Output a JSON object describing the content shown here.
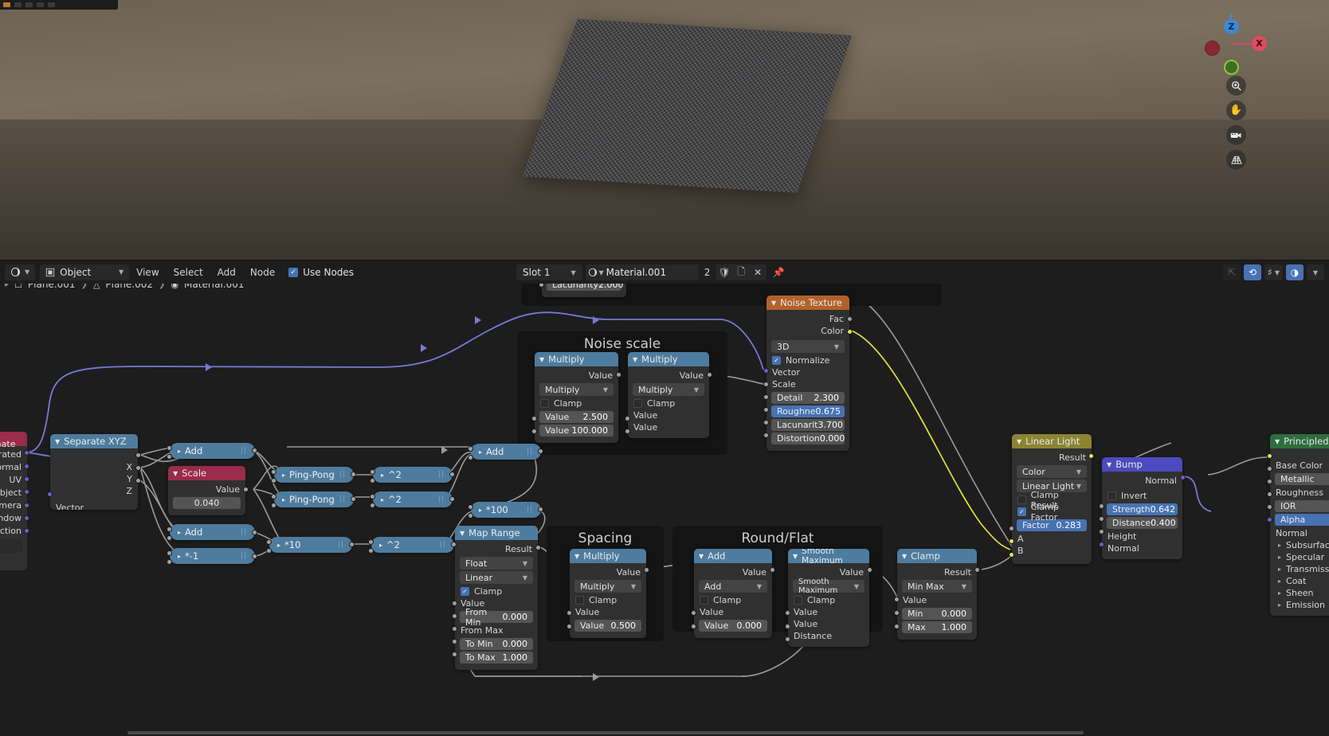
{
  "app": {
    "name": "Blender Shader Editor",
    "viewport": {
      "gizmo_axes": [
        "Z",
        "X"
      ],
      "tools": [
        {
          "name": "zoom-tool",
          "glyph": "⌕"
        },
        {
          "name": "pan-tool",
          "glyph": "✋"
        },
        {
          "name": "camera-tool",
          "glyph": "🎥"
        },
        {
          "name": "grid-tool",
          "glyph": "▦"
        }
      ]
    }
  },
  "header": {
    "editor_type": "shader-editor-icon",
    "shader_type": "Object",
    "menus": [
      "View",
      "Select",
      "Add",
      "Node"
    ],
    "use_nodes_label": "Use Nodes",
    "use_nodes_checked": true,
    "slot": "Slot 1",
    "material_name": "Material.001",
    "users_count": "2",
    "fake_user_icon": "shield-icon",
    "copy_icon": "copy-icon",
    "unlink_icon": "x-icon",
    "pin_icon": "pin-icon",
    "right_tools": [
      {
        "name": "snap-parent-icon",
        "glyph": "⤴",
        "active": false,
        "dim": true
      },
      {
        "name": "snap-magnet-icon",
        "glyph": "⟳",
        "active": true,
        "dim": false
      },
      {
        "name": "snap-target-icon",
        "glyph": "⌗",
        "active": false,
        "dim": false
      },
      {
        "name": "overlays-icon",
        "glyph": "◑",
        "active": true,
        "dim": false
      }
    ]
  },
  "breadcrumb": [
    {
      "icon": "object-icon",
      "label": "Plane.001"
    },
    {
      "icon": "mesh-data-icon",
      "label": "Plane.002"
    },
    {
      "icon": "material-icon",
      "label": "Material.001"
    }
  ],
  "frames": [
    {
      "title": "Noise scale"
    },
    {
      "title": "Spacing"
    },
    {
      "title": "Round/Flat"
    }
  ],
  "nodes": {
    "tex_coord": {
      "title": "Texture Coordinate",
      "outputs": [
        "Generated",
        "Normal",
        "UV",
        "Object",
        "Camera",
        "Window",
        "Reflection"
      ],
      "object_field": "Object"
    },
    "separate_xyz": {
      "title": "Separate XYZ",
      "outputs": [
        "X",
        "Y",
        "Z"
      ],
      "inputs": [
        "Vector"
      ]
    },
    "scale": {
      "title": "Scale",
      "output": "Value",
      "value": "0.040"
    },
    "add_top": {
      "title": "Add"
    },
    "add_mid": {
      "title": "Add"
    },
    "mul_neg1": {
      "title": "*-1"
    },
    "pingpong_1": {
      "title": "Ping-Pong"
    },
    "pingpong_2": {
      "title": "Ping-Pong"
    },
    "pow2_1": {
      "title": "^2"
    },
    "pow2_2": {
      "title": "^2"
    },
    "mul10": {
      "title": "*10"
    },
    "pow2_3": {
      "title": "^2"
    },
    "add_right": {
      "title": "Add"
    },
    "mul100": {
      "title": "*100"
    },
    "noise_mul_a": {
      "title": "Multiply",
      "output": "Value",
      "operation": "Multiply",
      "clamp_label": "Clamp",
      "clamp": false,
      "inputs": [
        {
          "label": "Value",
          "value": "2.500"
        },
        {
          "label": "Value",
          "value": "100.000"
        }
      ]
    },
    "noise_mul_b": {
      "title": "Multiply",
      "output": "Value",
      "operation": "Multiply",
      "clamp_label": "Clamp",
      "clamp": false,
      "inputs": [
        {
          "label": "Value",
          "value": ""
        },
        {
          "label": "Value",
          "value": ""
        }
      ]
    },
    "noise_texture": {
      "title": "Noise Texture",
      "outputs": [
        "Fac",
        "Color"
      ],
      "dimension": "3D",
      "normalize_label": "Normalize",
      "normalize": true,
      "inputs": [
        "Vector",
        "Scale"
      ],
      "values": [
        {
          "label": "Detail",
          "value": "2.300",
          "highlight": false
        },
        {
          "label": "Roughne",
          "value": "0.675",
          "highlight": true
        },
        {
          "label": "Lacunarit",
          "value": "3.700",
          "highlight": false
        },
        {
          "label": "Distortion",
          "value": "0.000",
          "highlight": false
        }
      ]
    },
    "map_range": {
      "title": "Map Range",
      "output": "Result",
      "data_type": "Float",
      "interpolation": "Linear",
      "clamp_label": "Clamp",
      "clamp": true,
      "inputs": [
        "Value",
        "From Max"
      ],
      "values": [
        {
          "label": "From Min",
          "value": "0.000"
        },
        {
          "label": "To Min",
          "value": "0.000"
        },
        {
          "label": "To Max",
          "value": "1.000"
        }
      ]
    },
    "spacing_multiply": {
      "title": "Multiply",
      "output": "Value",
      "operation": "Multiply",
      "clamp_label": "Clamp",
      "clamp": false,
      "input_label": "Value",
      "value_label": "Value",
      "value": "0.500"
    },
    "round_add": {
      "title": "Add",
      "output": "Value",
      "operation": "Add",
      "clamp_label": "Clamp",
      "clamp": false,
      "input_label": "Value",
      "value_label": "Value",
      "value": "0.000"
    },
    "smooth_max": {
      "title": "Smooth Maximum",
      "output": "Value",
      "operation": "Smooth Maximum",
      "clamp_label": "Clamp",
      "clamp": false,
      "inputs": [
        "Value",
        "Value",
        "Distance"
      ]
    },
    "clamp": {
      "title": "Clamp",
      "output": "Result",
      "mode": "Min Max",
      "input_label": "Value",
      "values": [
        {
          "label": "Min",
          "value": "0.000"
        },
        {
          "label": "Max",
          "value": "1.000"
        }
      ]
    },
    "linear_light": {
      "title": "Linear Light",
      "output": "Result",
      "data_type": "Color",
      "blend_mode": "Linear Light",
      "clamp_result_label": "Clamp Result",
      "clamp_result": false,
      "clamp_factor_label": "Clamp Factor",
      "clamp_factor": true,
      "factor_label": "Factor",
      "factor_value": "0.283",
      "inputs": [
        "A",
        "B"
      ]
    },
    "bump": {
      "title": "Bump",
      "output": "Normal",
      "invert_label": "Invert",
      "invert": false,
      "values": [
        {
          "label": "Strength",
          "value": "0.642",
          "highlight": true
        },
        {
          "label": "Distance",
          "value": "0.400",
          "highlight": false
        }
      ],
      "inputs": [
        "Height",
        "Normal"
      ]
    },
    "principled": {
      "title": "Principled BSDF",
      "sockets": [
        "Base Color",
        "Metallic",
        "Roughness",
        "IOR",
        "Alpha",
        "Normal"
      ],
      "metallic_highlight": false,
      "alpha_highlight": true,
      "panels": [
        "Subsurface",
        "Specular",
        "Transmission",
        "Coat",
        "Sheen",
        "Emission"
      ]
    },
    "top_partial": {
      "label": "Lacunarity",
      "value": "2.000"
    }
  },
  "colors": {
    "accent_blue": "#4772b3",
    "node_blue": "#4e7c9e",
    "node_red": "#9b2b4b",
    "node_orange": "#b1622a",
    "node_olive": "#8a8432",
    "node_purple": "#4b4bbf",
    "node_green": "#2e6d3d",
    "socket_yellow": "#e2e258",
    "socket_purple": "#6363c7",
    "socket_grey": "#a1a1a1"
  }
}
